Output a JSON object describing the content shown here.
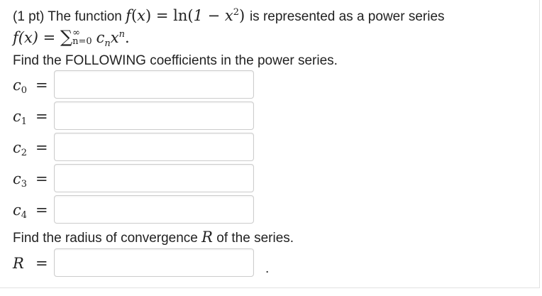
{
  "problem": {
    "points": "(1 pt)",
    "intro_text": "The function",
    "function_def": {
      "f": "f",
      "arg": "x",
      "rhs_fn": "ln",
      "rhs_inner": "1 − x",
      "exponent": "2"
    },
    "represented_text": "is represented as a power series",
    "series": {
      "lhs": "f(x) = ",
      "upper": "∞",
      "lower": "n=0",
      "term_c": "c",
      "term_sub": "n",
      "term_x": "x",
      "term_sup": "n",
      "end": "."
    },
    "coefficients_prompt": "Find the FOLLOWING coefficients in the power series.",
    "radius_prompt": {
      "before": "Find the radius of convergence",
      "symbol": "R",
      "after": "of the series."
    }
  },
  "fields": [
    {
      "letter": "c",
      "subscript": "0",
      "eq": "=",
      "value": ""
    },
    {
      "letter": "c",
      "subscript": "1",
      "eq": "=",
      "value": ""
    },
    {
      "letter": "c",
      "subscript": "2",
      "eq": "=",
      "value": ""
    },
    {
      "letter": "c",
      "subscript": "3",
      "eq": "=",
      "value": ""
    },
    {
      "letter": "c",
      "subscript": "4",
      "eq": "=",
      "value": ""
    }
  ],
  "radius_field": {
    "letter": "R",
    "eq": "=",
    "value": "",
    "trailing": "."
  }
}
